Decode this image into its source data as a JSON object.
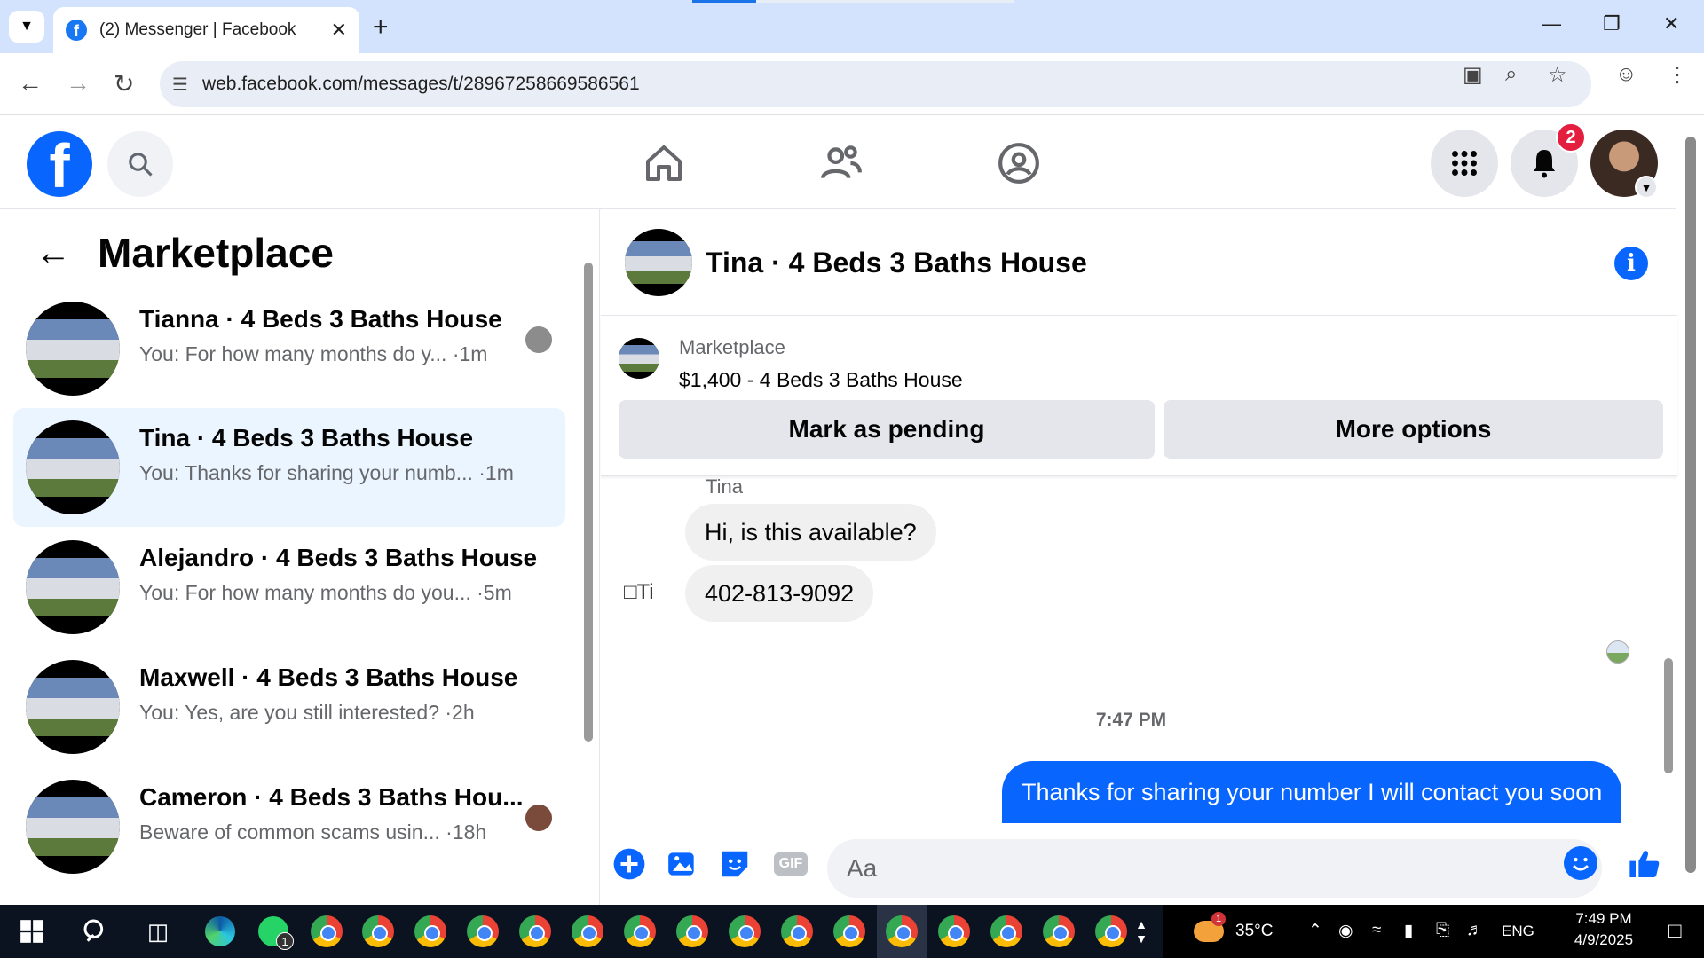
{
  "browser": {
    "tab_title": "(2) Messenger | Facebook",
    "url": "web.facebook.com/messages/t/28967258669586561"
  },
  "header": {
    "notification_count": "2"
  },
  "left": {
    "title": "Marketplace",
    "conversations": [
      {
        "name": "Tianna · 4 Beds 3 Baths House",
        "snippet": "You: For how many months do y... ·1m",
        "active": false
      },
      {
        "name": "Tina · 4 Beds 3 Baths House",
        "snippet": "You: Thanks for sharing your numb... ·1m",
        "active": true
      },
      {
        "name": "Alejandro · 4 Beds 3 Baths House",
        "snippet": "You: For how many months do you... ·5m",
        "active": false
      },
      {
        "name": "Maxwell · 4 Beds 3 Baths House",
        "snippet": "You: Yes, are you still interested? ·2h",
        "active": false
      },
      {
        "name": "Cameron · 4 Beds 3 Baths Hou...",
        "snippet": "Beware of common scams usin... ·18h",
        "active": false
      }
    ]
  },
  "chat": {
    "title": "Tina · 4 Beds 3 Baths House",
    "listing_label": "Marketplace",
    "listing_price": "$1,400 - 4 Beds 3 Baths House",
    "mark_pending_label": "Mark as pending",
    "more_options_label": "More options",
    "sender_name": "Tina",
    "avatar_alt": "Ti",
    "messages_in": [
      "Hi, is this available?",
      "402-813-9092"
    ],
    "timestamp": "7:47 PM",
    "message_out": "Thanks for sharing your number I will contact you soon",
    "composer_placeholder": "Aa",
    "gif_label": "GIF"
  },
  "taskbar": {
    "whatsapp_badge": "1",
    "weather_badge": "1",
    "temperature": "35°C",
    "language": "ENG",
    "time": "7:49 PM",
    "date": "4/9/2025"
  }
}
